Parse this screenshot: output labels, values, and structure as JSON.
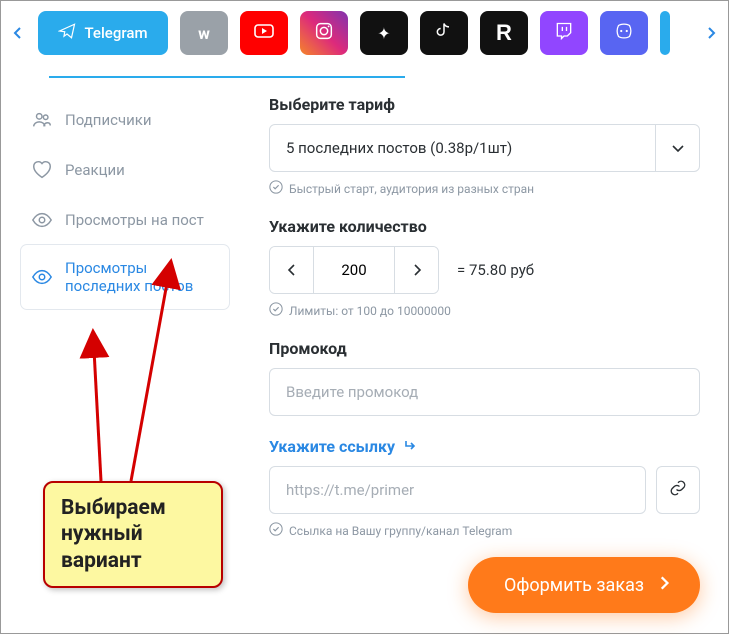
{
  "tabs": {
    "telegram": "Telegram"
  },
  "sidebar": {
    "items": [
      {
        "label": "Подписчики"
      },
      {
        "label": "Реакции"
      },
      {
        "label": "Просмотры на пост"
      },
      {
        "label": "Просмотры последних постов"
      }
    ]
  },
  "tariff": {
    "title": "Выберите тариф",
    "selected": "5 последних постов (0.38р/1шт)",
    "hint": "Быстрый старт, аудитория из разных стран"
  },
  "quantity": {
    "title": "Укажите количество",
    "value": "200",
    "price": "= 75.80 руб",
    "hint": "Лимиты: от 100 до 10000000"
  },
  "promo": {
    "title": "Промокод",
    "placeholder": "Введите промокод"
  },
  "link": {
    "title": "Укажите ссылку",
    "placeholder": "https://t.me/primer",
    "hint": "Ссылка на Вашу группу/канал Telegram"
  },
  "order_btn": "Оформить заказ",
  "callout": "Выбираем нужный вариант"
}
